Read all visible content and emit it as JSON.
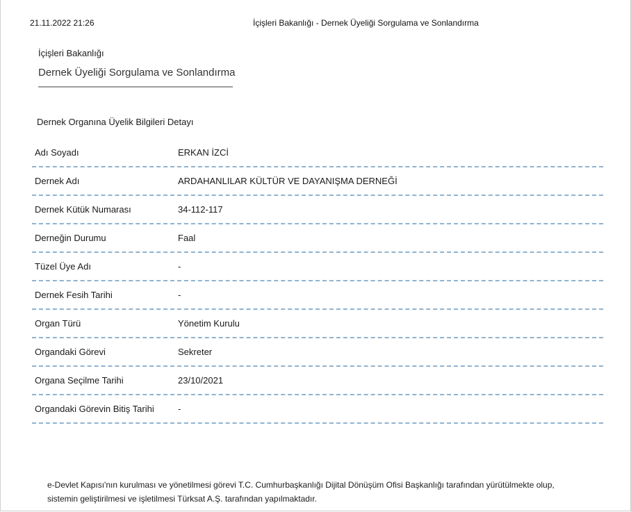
{
  "print_header": {
    "datetime": "21.11.2022 21:26",
    "title": "İçişleri Bakanlığı - Dernek Üyeliği Sorgulama ve Sonlandırma"
  },
  "page": {
    "ministry": "İçişleri Bakanlığı",
    "service": "Dernek Üyeliği Sorgulama ve Sonlandırma"
  },
  "section_title": "Dernek Organına Üyelik Bilgileri Detayı",
  "details": [
    {
      "label": "Adı Soyadı",
      "value": "ERKAN İZCİ"
    },
    {
      "label": "Dernek Adı",
      "value": "ARDAHANLILAR KÜLTÜR VE DAYANIŞMA DERNEĞİ"
    },
    {
      "label": "Dernek Kütük Numarası",
      "value": "34-112-117"
    },
    {
      "label": "Derneğin Durumu",
      "value": "Faal"
    },
    {
      "label": "Tüzel Üye Adı",
      "value": "-"
    },
    {
      "label": "Dernek Fesih Tarihi",
      "value": "-"
    },
    {
      "label": "Organ Türü",
      "value": "Yönetim Kurulu"
    },
    {
      "label": "Organdaki Görevi",
      "value": "Sekreter"
    },
    {
      "label": "Organa Seçilme Tarihi",
      "value": "23/10/2021"
    },
    {
      "label": "Organdaki Görevin Bitiş Tarihi",
      "value": "-"
    }
  ],
  "footer": {
    "line1": "e-Devlet Kapısı'nın kurulması ve yönetilmesi görevi T.C. Cumhurbaşkanlığı Dijital Dönüşüm Ofisi Başkanlığı tarafından yürütülmekte olup,",
    "line2": "sistemin geliştirilmesi ve işletilmesi Türksat A.Ş. tarafından yapılmaktadır."
  },
  "colors": {
    "row_divider": "#8fb3cf",
    "service_rule": "#9e9e9e"
  }
}
